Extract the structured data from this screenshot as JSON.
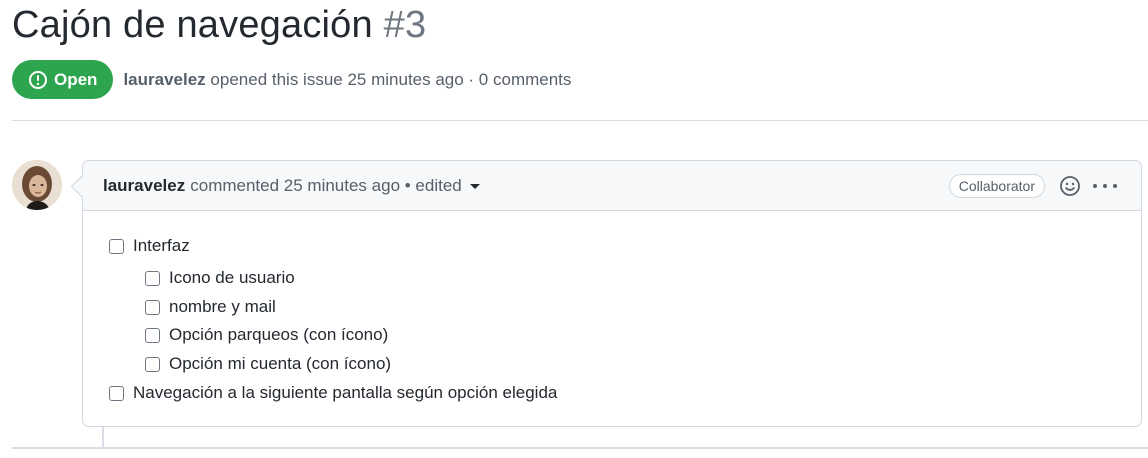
{
  "issue": {
    "title": "Cajón de navegación",
    "number": "#3",
    "state": "Open",
    "state_color": "#2da44e",
    "author": "lauravelez",
    "opened_text": "opened this issue 25 minutes ago · 0 comments"
  },
  "comment": {
    "author": "lauravelez",
    "meta": "commented 25 minutes ago • edited",
    "role": "Collaborator",
    "icons": [
      "smiley-icon",
      "kebab-menu-icon",
      "caret-down-icon",
      "issue-opened-icon"
    ],
    "tasks": [
      {
        "label": "Interfaz",
        "checked": false,
        "level": 0
      },
      {
        "label": "Icono de usuario",
        "checked": false,
        "level": 1
      },
      {
        "label": "nombre y mail",
        "checked": false,
        "level": 1
      },
      {
        "label": "Opción parqueos (con ícono)",
        "checked": false,
        "level": 1
      },
      {
        "label": "Opción mi cuenta (con ícono)",
        "checked": false,
        "level": 1
      },
      {
        "label": "Navegación a la siguiente pantalla según opción elegida",
        "checked": false,
        "level": 0
      }
    ]
  }
}
